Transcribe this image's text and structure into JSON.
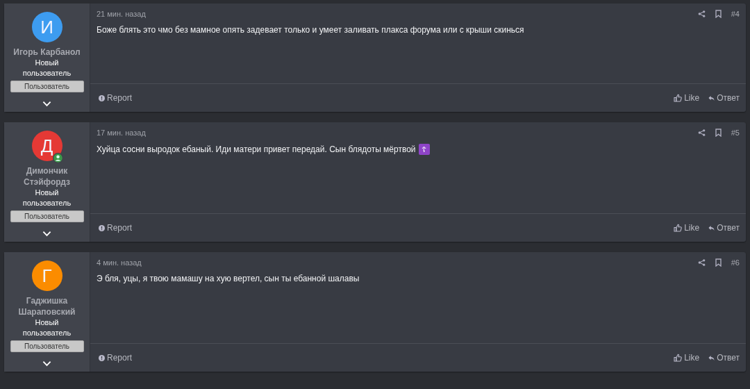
{
  "posts": [
    {
      "author": {
        "initial": "И",
        "color": "#3d9cf0",
        "online": false,
        "name": "Игорь Карбанол",
        "title": "Новый пользователь",
        "badge": "Пользователь"
      },
      "time": "21 мин. назад",
      "number": "#4",
      "text": "Боже блять это чмо без мамное опять задевает только и умеет заливать плакса форума или с крыши скинься",
      "report": "Report",
      "like": "Like",
      "reply": "Ответ"
    },
    {
      "author": {
        "initial": "Д",
        "color": "#e53935",
        "online": true,
        "name": "Димончик Стэйфордз",
        "title": "Новый пользователь",
        "badge": "Пользователь"
      },
      "time": "17 мин. назад",
      "number": "#5",
      "text": "Хуйца сосни выродок ебаный. Иди матери привет передай. Сын блядоты мёртвой",
      "emoji": "☦",
      "report": "Report",
      "like": "Like",
      "reply": "Ответ"
    },
    {
      "author": {
        "initial": "Г",
        "color": "#fb8c00",
        "online": false,
        "name": "Гаджишка Шараповский",
        "title": "Новый пользователь",
        "badge": "Пользователь"
      },
      "time": "4 мин. назад",
      "number": "#6",
      "text": "Э бля, уцы, я твою мамашу на хую вертел, сын ты ебанной шалавы",
      "report": "Report",
      "like": "Like",
      "reply": "Ответ"
    }
  ]
}
